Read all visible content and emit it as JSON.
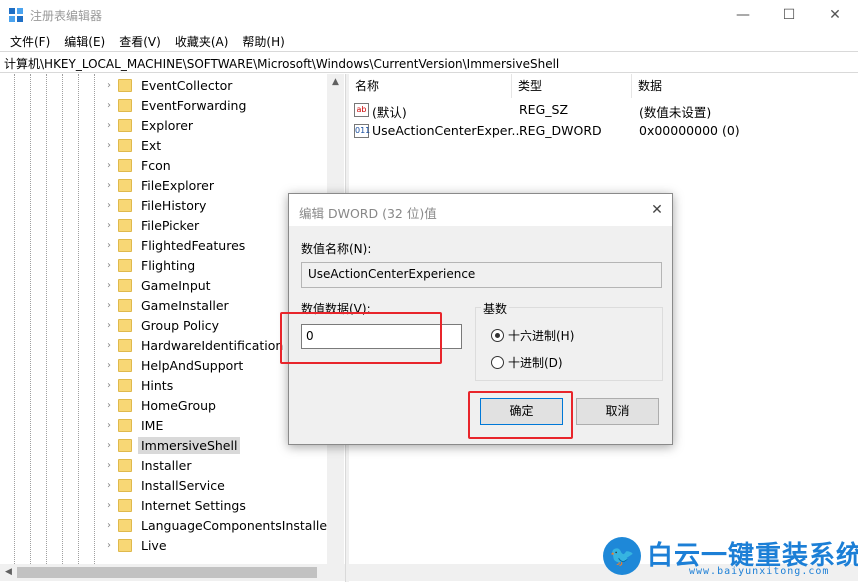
{
  "window": {
    "title": "注册表编辑器",
    "min": "—",
    "max": "☐",
    "close": "✕"
  },
  "menu": [
    "文件(F)",
    "编辑(E)",
    "查看(V)",
    "收藏夹(A)",
    "帮助(H)"
  ],
  "address": "计算机\\HKEY_LOCAL_MACHINE\\SOFTWARE\\Microsoft\\Windows\\CurrentVersion\\ImmersiveShell",
  "tree": {
    "items": [
      "EventCollector",
      "EventForwarding",
      "Explorer",
      "Ext",
      "Fcon",
      "FileExplorer",
      "FileHistory",
      "FilePicker",
      "FlightedFeatures",
      "Flighting",
      "GameInput",
      "GameInstaller",
      "Group Policy",
      "HardwareIdentification",
      "HelpAndSupport",
      "Hints",
      "HomeGroup",
      "IME",
      "ImmersiveShell",
      "Installer",
      "InstallService",
      "Internet Settings",
      "LanguageComponentsInstaller",
      "Live"
    ],
    "selected": "ImmersiveShell"
  },
  "values": {
    "headers": {
      "name": "名称",
      "type": "类型",
      "data": "数据"
    },
    "rows": [
      {
        "icon": "ab",
        "name": "(默认)",
        "type": "REG_SZ",
        "data": "(数值未设置)"
      },
      {
        "icon": "011",
        "name": "UseActionCenterExper...",
        "type": "REG_DWORD",
        "data": "0x00000000 (0)"
      }
    ]
  },
  "dialog": {
    "title": "编辑 DWORD (32 位)值",
    "close": "✕",
    "value_name_label": "数值名称(N):",
    "value_name": "UseActionCenterExperience",
    "value_data_label": "数值数据(V):",
    "value_data": "0",
    "base_label": "基数",
    "radio_hex": "十六进制(H)",
    "radio_dec": "十进制(D)",
    "base_selected": "hex",
    "ok": "确定",
    "cancel": "取消"
  },
  "watermark": {
    "text": "白云一键重装系统",
    "url": "www.baiyunxitong.com",
    "logo_icon": "bird-icon"
  },
  "colors": {
    "annotation": "#e8252b",
    "watermark": "#1c7fd6",
    "folder": "#f8d775",
    "accent": "#0078d7"
  }
}
